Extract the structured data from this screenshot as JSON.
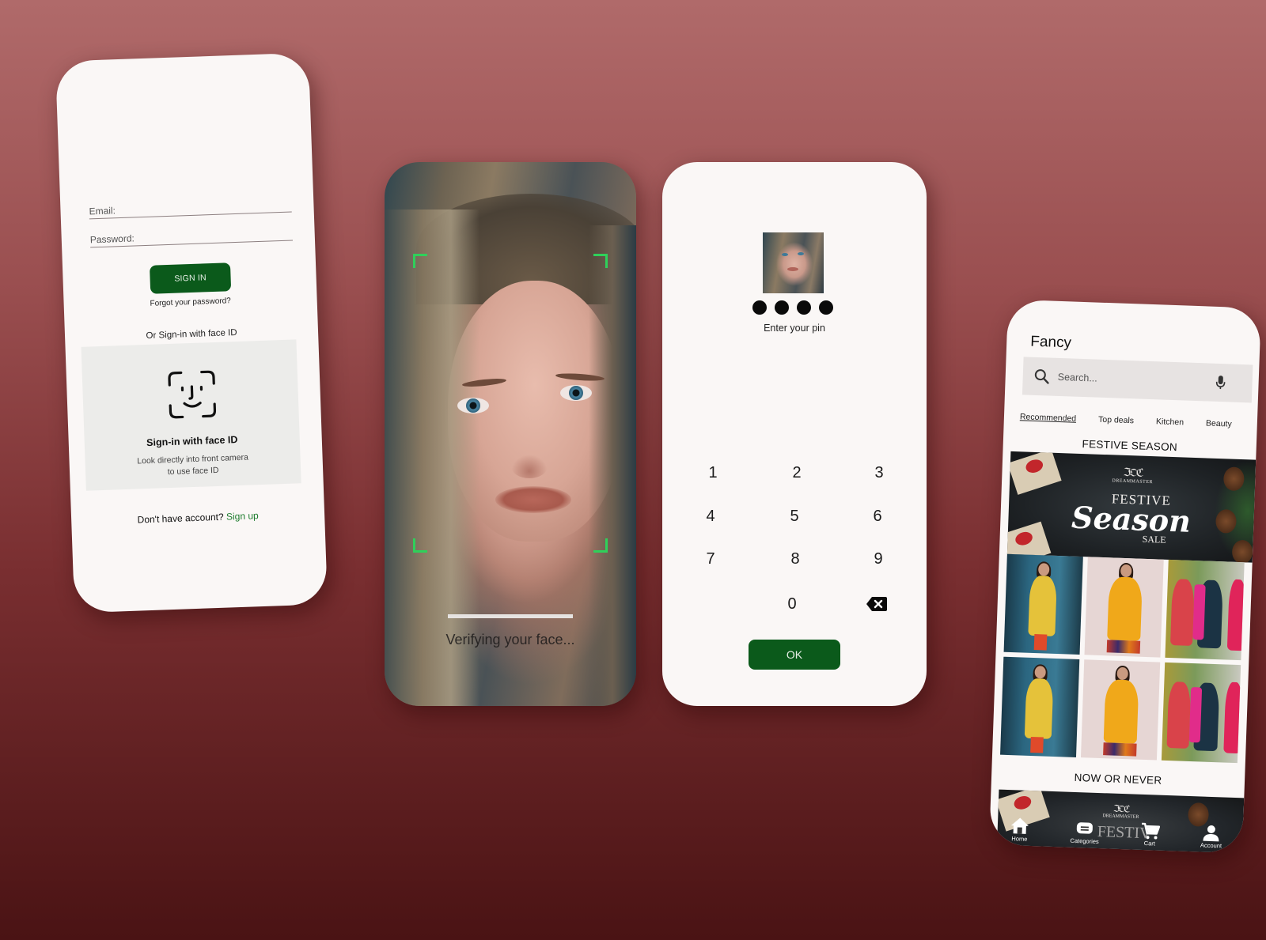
{
  "colors": {
    "background_top": "#b06a6a",
    "background_bottom": "#4a1314",
    "card": "#faf7f6",
    "primary_green": "#0b5a1b",
    "link_green": "#1e7d2f",
    "scan_frame": "#2fd05a"
  },
  "login": {
    "email_label": "Email:",
    "password_label": "Password:",
    "signin_button": "SIGN IN",
    "forgot_password": "Forgot your password?",
    "or_face": "Or Sign-in with face ID",
    "face_card": {
      "icon": "face-id-icon",
      "title": "Sign-in with face ID",
      "desc_line1": "Look directly into front camera",
      "desc_line2": "to use face ID"
    },
    "no_account": "Don't have account?",
    "signup_link": "Sign up"
  },
  "face_verify": {
    "status_text": "Verifying your face...",
    "progress_percent": 100
  },
  "pin": {
    "avatar": "user-avatar-photo",
    "digits_entered": 4,
    "label": "Enter your pin",
    "keys": [
      "1",
      "2",
      "3",
      "4",
      "5",
      "6",
      "7",
      "8",
      "9",
      "0"
    ],
    "backspace_icon": "backspace-icon",
    "ok_button": "OK"
  },
  "shop": {
    "title": "Fancy",
    "search_placeholder": "Search...",
    "search_icon": "search-icon",
    "mic_icon": "mic-icon",
    "tabs": [
      {
        "label": "Recommended",
        "active": true
      },
      {
        "label": "Top deals",
        "active": false
      },
      {
        "label": "Kitchen",
        "active": false
      },
      {
        "label": "Beauty",
        "active": false
      }
    ],
    "section1_title": "FESTIVE SEASON",
    "banner": {
      "brand": "DREAMMASTER",
      "line1": "FESTIVE",
      "line2": "Season",
      "line3": "SALE"
    },
    "products": [
      {
        "name": "yellow-kurta-blue-room"
      },
      {
        "name": "mustard-anarkali-printed-skirt"
      },
      {
        "name": "red-navy-suit-set"
      },
      {
        "name": "yellow-kurta-blue-room"
      },
      {
        "name": "mustard-anarkali-printed-skirt"
      },
      {
        "name": "red-navy-suit-set"
      }
    ],
    "section2_title": "NOW OR NEVER",
    "banner2_text": "FESTIV",
    "nav": [
      {
        "label": "Home",
        "icon": "home-icon"
      },
      {
        "label": "Categories",
        "icon": "categories-icon"
      },
      {
        "label": "Cart",
        "icon": "cart-icon"
      },
      {
        "label": "Account",
        "icon": "account-icon"
      }
    ]
  }
}
